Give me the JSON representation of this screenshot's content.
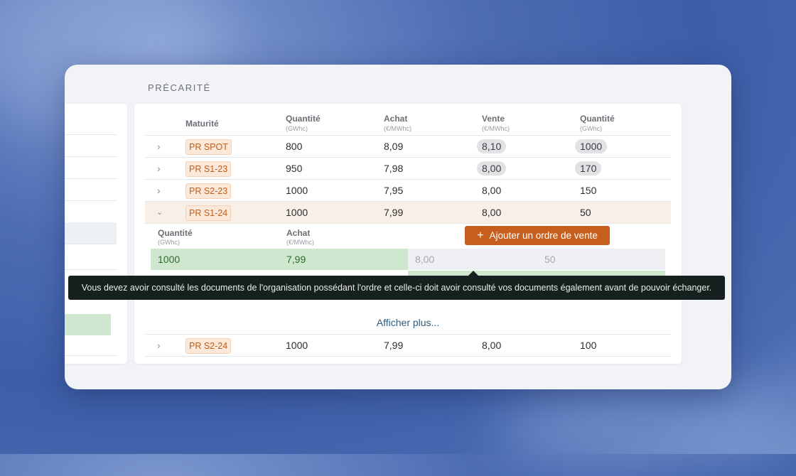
{
  "section": {
    "title": "PRÉCARITÉ"
  },
  "table": {
    "headers": [
      {
        "label": "Maturité",
        "unit": ""
      },
      {
        "label": "Quantité",
        "unit": "(GWhc)"
      },
      {
        "label": "Achat",
        "unit": "(€/MWhc)"
      },
      {
        "label": "Vente",
        "unit": "(€/MWhc)"
      },
      {
        "label": "Quantité",
        "unit": "(GWhc)"
      }
    ],
    "rows": [
      {
        "maturity": "PR SPOT",
        "qty_buy": "800",
        "buy": "8,09",
        "sell": "8,10",
        "qty_sell": "1000"
      },
      {
        "maturity": "PR S1-23",
        "qty_buy": "950",
        "buy": "7,98",
        "sell": "8,00",
        "qty_sell": "170"
      },
      {
        "maturity": "PR S2-23",
        "qty_buy": "1000",
        "buy": "7,95",
        "sell": "8,00",
        "qty_sell": "150"
      },
      {
        "maturity": "PR S1-24",
        "qty_buy": "1000",
        "buy": "7,99",
        "sell": "8,00",
        "qty_sell": "50"
      }
    ],
    "last_row": {
      "maturity": "PR S2-24",
      "qty_buy": "1000",
      "buy": "7,99",
      "sell": "8,00",
      "qty_sell": "100"
    }
  },
  "expanded": {
    "headers": [
      {
        "label": "Quantité",
        "unit": "(GWhc)"
      },
      {
        "label": "Achat",
        "unit": "(€/MWhc)"
      }
    ],
    "add_sell_button": "Ajouter un ordre de vente",
    "order": {
      "qty_buy": "1000",
      "buy": "7,99",
      "sell": "8,00",
      "qty_sell": "50"
    }
  },
  "show_more": "Afficher plus...",
  "tooltip": "Vous devez avoir consulté les documents de l'organisation possédant l'ordre et celle-ci doit avoir consulté vos documents également avant de pouvoir échanger.",
  "icons": {
    "expand": "chevron-right-icon",
    "collapse": "chevron-down-icon",
    "add": "plus-icon"
  },
  "colors": {
    "accent": "#c65f1d",
    "tag_bg": "#fbe8d8",
    "buy_highlight": "#cfe6cf",
    "tooltip_bg": "#15201f"
  }
}
